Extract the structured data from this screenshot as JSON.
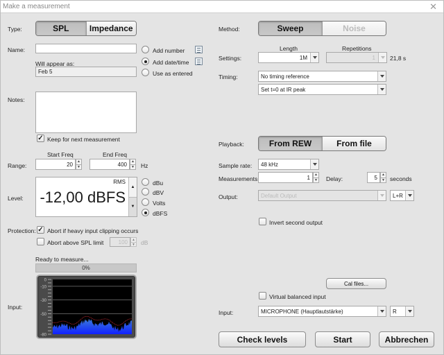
{
  "window": {
    "title": "Make a measurement",
    "close_icon": "close-icon"
  },
  "type": {
    "label": "Type:",
    "options": [
      "SPL",
      "Impedance"
    ],
    "selected": "SPL"
  },
  "name": {
    "label": "Name:",
    "value": "",
    "will_appear_label": "Will appear as:",
    "will_appear_value": "Feb 5",
    "options": [
      "Add number",
      "Add date/time",
      "Use as entered"
    ],
    "selected": "Add date/time"
  },
  "notes": {
    "label": "Notes:",
    "value": "",
    "keep_label": "Keep for next measurement",
    "keep_checked": true
  },
  "range": {
    "label": "Range:",
    "start_label": "Start Freq",
    "start_value": "20",
    "end_label": "End Freq",
    "end_value": "400",
    "unit": "Hz"
  },
  "level": {
    "label": "Level:",
    "mode": "RMS",
    "value": "-12,00 dBFS",
    "units": [
      "dBu",
      "dBV",
      "Volts",
      "dBFS"
    ],
    "selected_unit": "dBFS"
  },
  "protection": {
    "label": "Protection:",
    "abort_clipping_label": "Abort if heavy input clipping occurs",
    "abort_clipping_checked": true,
    "abort_spl_label": "Abort above SPL limit",
    "abort_spl_checked": false,
    "spl_limit": "100",
    "spl_unit": "dB"
  },
  "progress": {
    "status": "Ready to measure...",
    "percent_label": "0%",
    "value": 0
  },
  "input_meter": {
    "label": "Input:",
    "scale": [
      "0",
      "-10",
      "-30",
      "-50",
      "-80"
    ]
  },
  "method": {
    "label": "Method:",
    "options": [
      "Sweep",
      "Noise"
    ],
    "selected": "Sweep"
  },
  "settings": {
    "label": "Settings:",
    "length_label": "Length",
    "length_value": "1M",
    "repetitions_label": "Repetitions",
    "repetitions_value": "1",
    "duration": "21,8 s"
  },
  "timing": {
    "label": "Timing:",
    "reference": "No timing reference",
    "t0": "Set t=0 at IR peak"
  },
  "playback": {
    "label": "Playback:",
    "options": [
      "From REW",
      "From file"
    ],
    "selected": "From REW"
  },
  "sample_rate": {
    "label": "Sample rate:",
    "value": "48 kHz"
  },
  "measurements": {
    "label": "Measurements:",
    "value": "1",
    "delay_label": "Delay:",
    "delay_value": "5",
    "delay_unit": "seconds"
  },
  "output": {
    "label": "Output:",
    "device": "Default Output",
    "channel": "L+R",
    "invert_label": "Invert second output",
    "invert_checked": false
  },
  "cal_files_label": "Cal files...",
  "input": {
    "virtual_balanced_label": "Virtual balanced input",
    "virtual_balanced_checked": false,
    "label": "Input:",
    "device": "MICROPHONE (Hauptlautstärke)",
    "channel": "R"
  },
  "buttons": {
    "check_levels": "Check levels",
    "start": "Start",
    "cancel": "Abbrechen"
  }
}
